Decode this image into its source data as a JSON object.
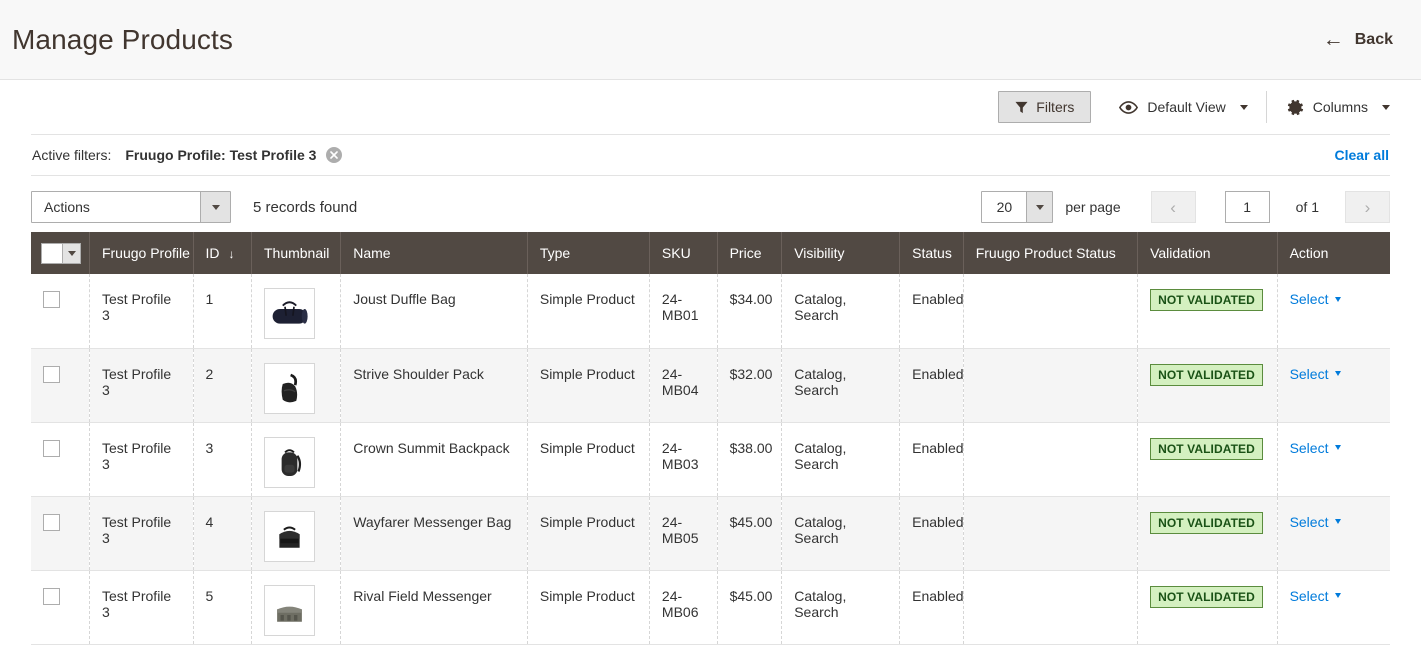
{
  "header": {
    "title": "Manage Products",
    "back_label": "Back",
    "back_icon": "arrow-left-icon"
  },
  "toolbar": {
    "filters_label": "Filters",
    "filters_icon": "funnel-icon",
    "view_label": "Default View",
    "view_icon": "eye-icon",
    "columns_label": "Columns",
    "columns_icon": "gear-icon"
  },
  "active_filters": {
    "label": "Active filters:",
    "chips": [
      {
        "text": "Fruugo Profile: Test Profile 3",
        "remove_icon": "close-circle-icon"
      }
    ],
    "clear_all_label": "Clear all"
  },
  "grid_controls": {
    "actions_label": "Actions",
    "records_found": "5 records found",
    "per_page_value": "20",
    "per_page_label": "per page",
    "prev_icon": "chevron-left-icon",
    "next_icon": "chevron-right-icon",
    "page_value": "1",
    "of_label": "of 1"
  },
  "table": {
    "columns": [
      {
        "key": "select",
        "label": ""
      },
      {
        "key": "profile",
        "label": "Fruugo Profile"
      },
      {
        "key": "id",
        "label": "ID",
        "sorted": "desc",
        "sort_icon": "arrow-down-icon"
      },
      {
        "key": "thumbnail",
        "label": "Thumbnail"
      },
      {
        "key": "name",
        "label": "Name"
      },
      {
        "key": "type",
        "label": "Type"
      },
      {
        "key": "sku",
        "label": "SKU"
      },
      {
        "key": "price",
        "label": "Price"
      },
      {
        "key": "visibility",
        "label": "Visibility"
      },
      {
        "key": "status",
        "label": "Status"
      },
      {
        "key": "fruugo_status",
        "label": "Fruugo Product Status"
      },
      {
        "key": "validation",
        "label": "Validation"
      },
      {
        "key": "action",
        "label": "Action"
      }
    ],
    "rows": [
      {
        "profile": "Test Profile 3",
        "id": "1",
        "thumbnail": "duffle-bag-thumbnail",
        "name": "Joust Duffle Bag",
        "type": "Simple Product",
        "sku": "24-MB01",
        "price": "$34.00",
        "visibility": "Catalog, Search",
        "status": "Enabled",
        "fruugo_status": "",
        "validation": "NOT VALIDATED",
        "action": "Select"
      },
      {
        "profile": "Test Profile 3",
        "id": "2",
        "thumbnail": "shoulder-pack-thumbnail",
        "name": "Strive Shoulder Pack",
        "type": "Simple Product",
        "sku": "24-MB04",
        "price": "$32.00",
        "visibility": "Catalog, Search",
        "status": "Enabled",
        "fruugo_status": "",
        "validation": "NOT VALIDATED",
        "action": "Select"
      },
      {
        "profile": "Test Profile 3",
        "id": "3",
        "thumbnail": "backpack-thumbnail",
        "name": "Crown Summit Backpack",
        "type": "Simple Product",
        "sku": "24-MB03",
        "price": "$38.00",
        "visibility": "Catalog, Search",
        "status": "Enabled",
        "fruugo_status": "",
        "validation": "NOT VALIDATED",
        "action": "Select"
      },
      {
        "profile": "Test Profile 3",
        "id": "4",
        "thumbnail": "messenger-bag-thumbnail",
        "name": "Wayfarer Messenger Bag",
        "type": "Simple Product",
        "sku": "24-MB05",
        "price": "$45.00",
        "visibility": "Catalog, Search",
        "status": "Enabled",
        "fruugo_status": "",
        "validation": "NOT VALIDATED",
        "action": "Select"
      },
      {
        "profile": "Test Profile 3",
        "id": "5",
        "thumbnail": "field-messenger-thumbnail",
        "name": "Rival Field Messenger",
        "type": "Simple Product",
        "sku": "24-MB06",
        "price": "$45.00",
        "visibility": "Catalog, Search",
        "status": "Enabled",
        "fruugo_status": "",
        "validation": "NOT VALIDATED",
        "action": "Select"
      }
    ]
  },
  "colors": {
    "header_bar": "#514943",
    "accent_link": "#007bdb",
    "badge_bg": "#d4f0c0",
    "badge_border": "#5b8c3e",
    "badge_text": "#1a5216",
    "title_text": "#41362f"
  }
}
